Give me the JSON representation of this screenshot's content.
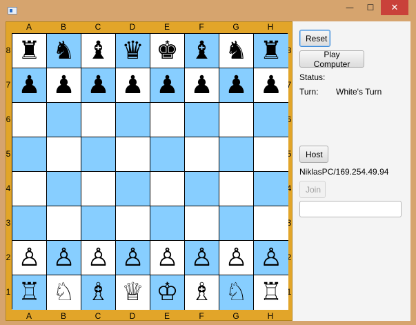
{
  "window": {
    "title": "",
    "minimize_glyph": "—",
    "maximize_glyph": "☐",
    "close_glyph": "✕"
  },
  "board": {
    "files": [
      "A",
      "B",
      "C",
      "D",
      "E",
      "F",
      "G",
      "H"
    ],
    "ranks": [
      "8",
      "7",
      "6",
      "5",
      "4",
      "3",
      "2",
      "1"
    ],
    "light_color": "#ffffff",
    "dark_color": "#87ceff",
    "frame_color": "#e2a529",
    "rows": [
      [
        "♜",
        "♞",
        "♝",
        "♛",
        "♚",
        "♝",
        "♞",
        "♜"
      ],
      [
        "♟",
        "♟",
        "♟",
        "♟",
        "♟",
        "♟",
        "♟",
        "♟"
      ],
      [
        "",
        "",
        "",
        "",
        "",
        "",
        "",
        ""
      ],
      [
        "",
        "",
        "",
        "",
        "",
        "",
        "",
        ""
      ],
      [
        "",
        "",
        "",
        "",
        "",
        "",
        "",
        ""
      ],
      [
        "",
        "",
        "",
        "",
        "",
        "",
        "",
        ""
      ],
      [
        "♙",
        "♙",
        "♙",
        "♙",
        "♙",
        "♙",
        "♙",
        "♙"
      ],
      [
        "♖",
        "♘",
        "♗",
        "♕",
        "♔",
        "♗",
        "♘",
        "♖"
      ]
    ]
  },
  "panel": {
    "reset_label": "Reset",
    "play_computer_label": "Play Computer",
    "status_label": "Status:",
    "status_value": "",
    "turn_label": "Turn:",
    "turn_value": "White's Turn",
    "host_label": "Host",
    "host_address": "NiklasPC/169.254.49.94",
    "join_label": "Join",
    "join_address_value": ""
  }
}
